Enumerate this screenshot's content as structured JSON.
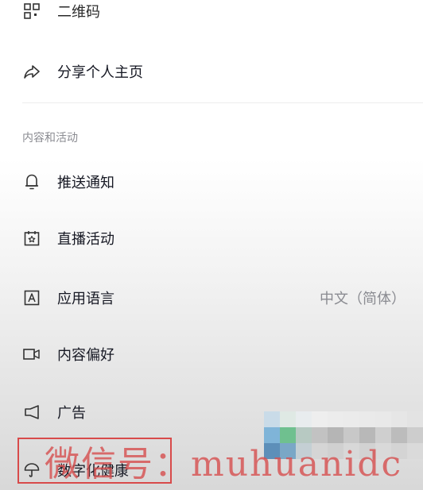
{
  "menu_top": {
    "cutoff_label": "二维码",
    "share_label": "分享个人主页"
  },
  "section": {
    "title": "内容和活动"
  },
  "items": [
    {
      "label": "推送通知",
      "icon": "bell-icon"
    },
    {
      "label": "直播活动",
      "icon": "live-calendar-icon"
    },
    {
      "label": "应用语言",
      "icon": "language-a-icon",
      "value": "中文（简体）"
    },
    {
      "label": "内容偏好",
      "icon": "video-camera-icon"
    },
    {
      "label": "广告",
      "icon": "megaphone-icon"
    }
  ],
  "bottom_item": {
    "label": "数字化健康",
    "icon": "umbrella-icon"
  },
  "watermark": {
    "text": "微信号：muhuanidc"
  },
  "colors": {
    "text": "#161823",
    "secondary": "#8a8b91",
    "watermark": "#d84a4a"
  }
}
